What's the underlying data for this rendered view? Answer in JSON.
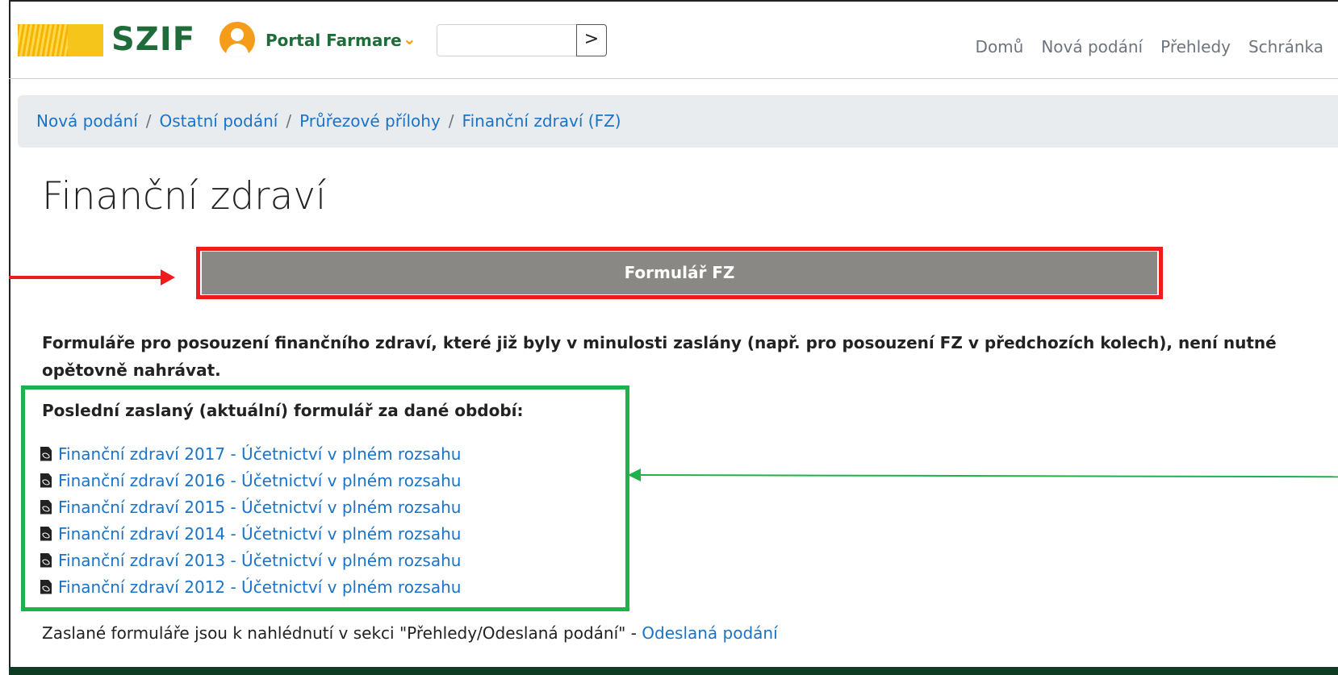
{
  "header": {
    "logo_text": "SZIF",
    "portal_label": "Portal Farmare",
    "search": {
      "value": "",
      "placeholder": ""
    },
    "search_button_label": ">",
    "nav": [
      "Domů",
      "Nová podání",
      "Přehledy",
      "Schránka"
    ]
  },
  "breadcrumb": [
    "Nová podání",
    "Ostatní podání",
    "Průřezové přílohy",
    "Finanční zdraví (FZ)"
  ],
  "breadcrumb_separator": "/",
  "page": {
    "title": "Finanční zdraví",
    "form_button_label": "Formulář FZ",
    "info_text": "Formuláře pro posouzení finančního zdraví, které již byly v minulosti zaslány (např. pro posouzení FZ v předchozích kolech), není nutné opětovně nahrávat.",
    "last_forms_label": "Poslední zaslaný (aktuální) formulář za dané období:",
    "files": [
      "Finanční zdraví 2017 - Účetnictví v plném rozsahu",
      "Finanční zdraví 2016 - Účetnictví v plném rozsahu",
      "Finanční zdraví 2015 - Účetnictví v plném rozsahu",
      "Finanční zdraví 2014 - Účetnictví v plném rozsahu",
      "Finanční zdraví 2013 - Účetnictví v plném rozsahu",
      "Finanční zdraví 2012 - Účetnictví v plném rozsahu"
    ],
    "footer_text": "Zaslané formuláře jsou k nahlédnutí v sekci \"Přehledy/Odeslaná podání\" - ",
    "footer_link": "Odeslaná podání"
  },
  "colors": {
    "brand_green": "#1f6b3a",
    "accent_orange": "#f59c1a",
    "link_blue": "#1a73c7",
    "highlight_red": "#ee1c1c",
    "highlight_green": "#1fb14c",
    "button_gray": "#8a8884",
    "footer_dark": "#0e3b22"
  },
  "icons": {
    "user": "user-circle-icon",
    "dropdown": "chevron-down-icon",
    "search_go": "chevron-right-icon",
    "file": "pdf-file-icon"
  }
}
